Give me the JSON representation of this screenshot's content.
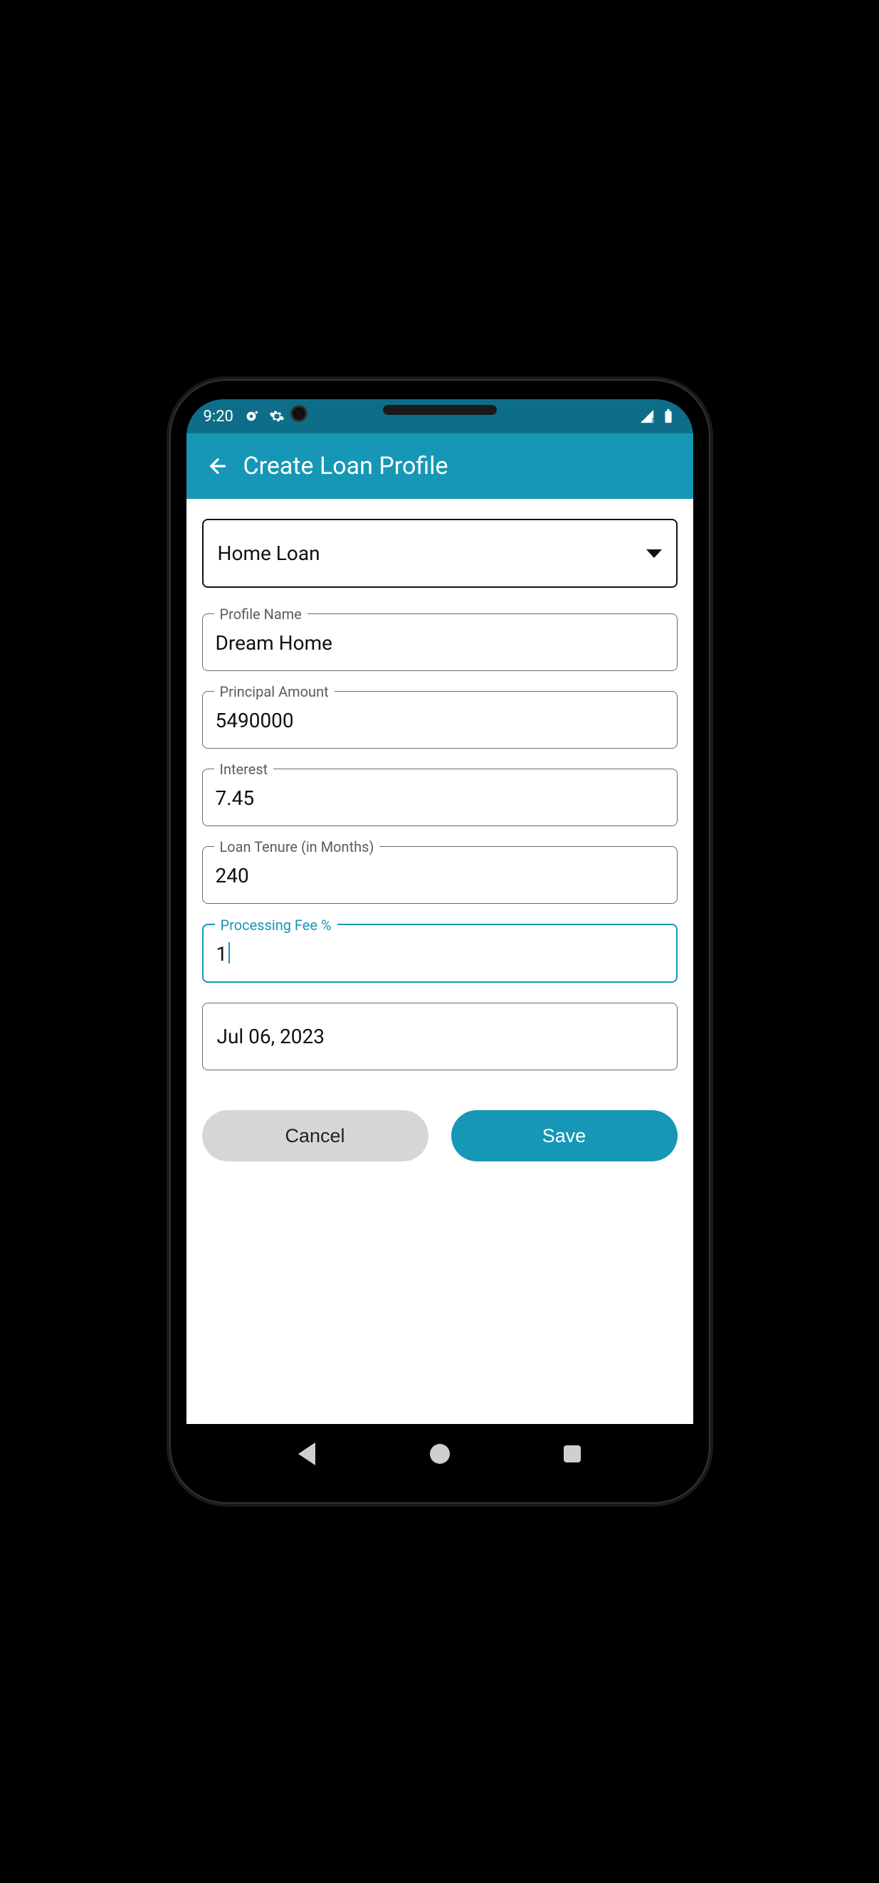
{
  "status": {
    "time": "9:20"
  },
  "appbar": {
    "title": "Create Loan Profile"
  },
  "form": {
    "loan_type": {
      "value": "Home Loan"
    },
    "profile_name": {
      "label": "Profile Name",
      "value": "Dream Home"
    },
    "principal": {
      "label": "Principal Amount",
      "value": "5490000"
    },
    "interest": {
      "label": "Interest",
      "value": "7.45"
    },
    "tenure": {
      "label": "Loan Tenure (in Months)",
      "value": "240"
    },
    "processing_fee": {
      "label": "Processing Fee %",
      "value": "1"
    },
    "start_date": {
      "value": "Jul 06, 2023"
    }
  },
  "buttons": {
    "cancel": "Cancel",
    "save": "Save"
  }
}
